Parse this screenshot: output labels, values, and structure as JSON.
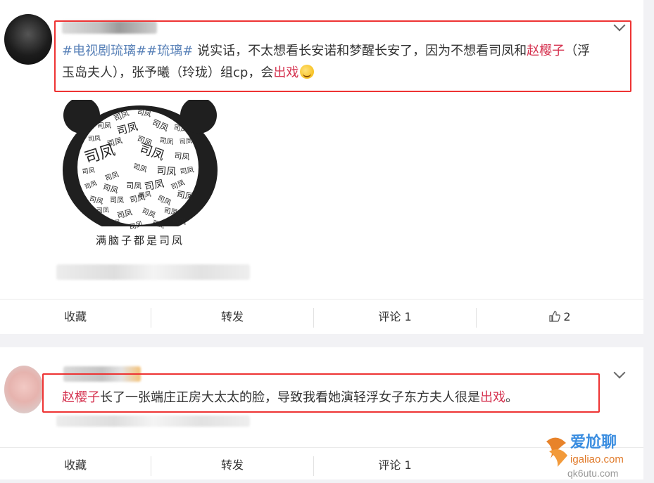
{
  "post1": {
    "tag1": "#电视剧琉璃#",
    "tag2": "#琉璃#",
    "text_a": " 说实话，不太想看长安诺和梦醒长安了，因为不想看司凤和",
    "name": "赵樱子",
    "text_b": "（浮",
    "text_c": "玉岛夫人），张予曦（玲珑）组cp，会",
    "keyword": "出戏",
    "emoji_icon": "laughing-tears-emoji",
    "meme": {
      "caption": "满脑子都是司凤",
      "words": [
        "司凤",
        "司凤",
        "司凤",
        "司凤",
        "司凤",
        "司凤",
        "司凤",
        "司凤",
        "司凤",
        "司凤",
        "司凤",
        "司凤",
        "司凤",
        "司凤",
        "司凤",
        "司凤",
        "司凤",
        "司凤",
        "司凤",
        "司凤",
        "司凤",
        "司凤",
        "司凤",
        "司凤",
        "司凤",
        "司凤",
        "司凤",
        "司凤",
        "司凤",
        "司凤",
        "司凤",
        "司凤",
        "司凤",
        "司凤",
        "司凤",
        "司凤",
        "司凤",
        "司凤"
      ]
    },
    "actions": {
      "favorite": "收藏",
      "repost": "转发",
      "comment": "评论 1",
      "like_count": "2"
    }
  },
  "post2": {
    "name": "赵樱子",
    "text_a": "长了一张端庄正房大太太的脸，导致我看她演轻浮女子东方夫人很是",
    "keyword": "出戏",
    "text_b": "。",
    "actions": {
      "favorite": "收藏",
      "repost": "转发",
      "comment": "评论 1"
    }
  },
  "watermark": {
    "line1": "爱尬聊",
    "line2": "igaliao.com",
    "line3": "qk6utu.com"
  },
  "colors": {
    "tag": "#5a82b8",
    "highlight_word": "#d5324f",
    "annotation_border": "#e33",
    "background": "#f2f2f5"
  }
}
